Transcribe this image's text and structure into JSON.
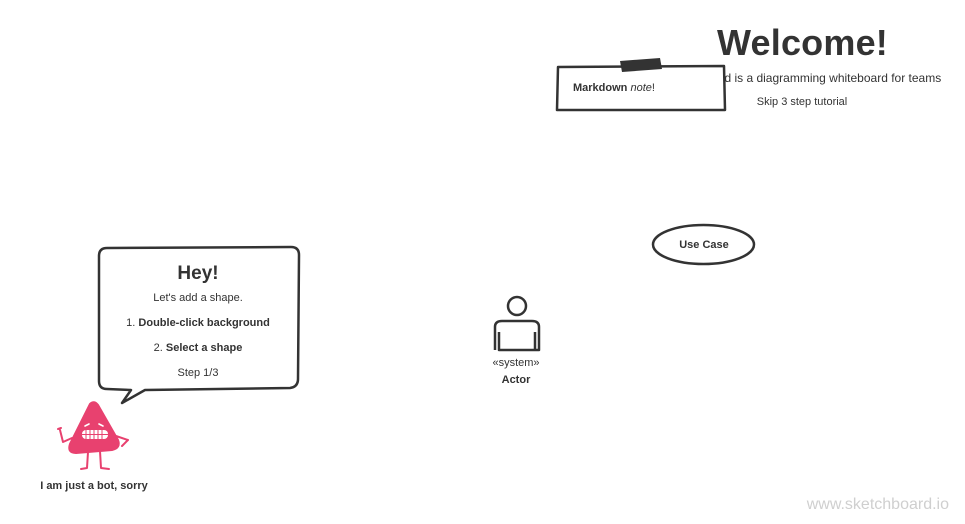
{
  "welcome": {
    "title": "Welcome!",
    "subtitle": "Sketchboard is a diagramming whiteboard for teams",
    "skip_label": "Skip 3 step tutorial"
  },
  "note": {
    "bold_text": "Markdown",
    "italic_text": "note",
    "suffix": "!"
  },
  "use_case": {
    "label": "Use Case"
  },
  "actor": {
    "stereotype": "«system»",
    "label": "Actor"
  },
  "tutorial": {
    "heading": "Hey!",
    "intro": "Let's add a shape.",
    "step1_number": "1.",
    "step1_text": "Double-click background",
    "step2_number": "2.",
    "step2_text": "Select a shape",
    "progress": "Step 1/3"
  },
  "bot": {
    "caption": "I am just a bot, sorry",
    "color": "#e8416f"
  },
  "watermark": "www.sketchboard.io",
  "colors": {
    "stroke": "#333333",
    "background": "#ffffff",
    "watermark": "#cfcfcf"
  }
}
